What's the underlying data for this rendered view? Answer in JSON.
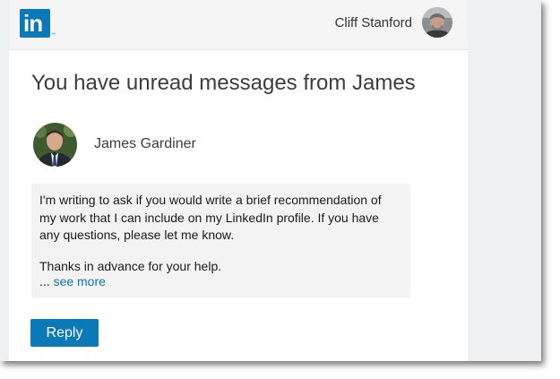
{
  "brand": {
    "logo_text": "in",
    "logo_tm": "™",
    "accent_color": "#0b78b7"
  },
  "header": {
    "user_name": "Cliff Stanford",
    "user_avatar_icon": "avatar-photo-icon"
  },
  "notification": {
    "headline": "You have unread messages from James",
    "sender_name": "James Gardiner",
    "sender_avatar_icon": "avatar-photo-icon",
    "message_lines": [
      "I'm writing to ask if you would write a brief recommendation of",
      "my work that I can include on my LinkedIn profile. If you have",
      "any questions, please let me know.",
      "Thanks in advance for your help."
    ],
    "ellipsis": "... ",
    "see_more_label": "see more",
    "reply_label": "Reply"
  }
}
